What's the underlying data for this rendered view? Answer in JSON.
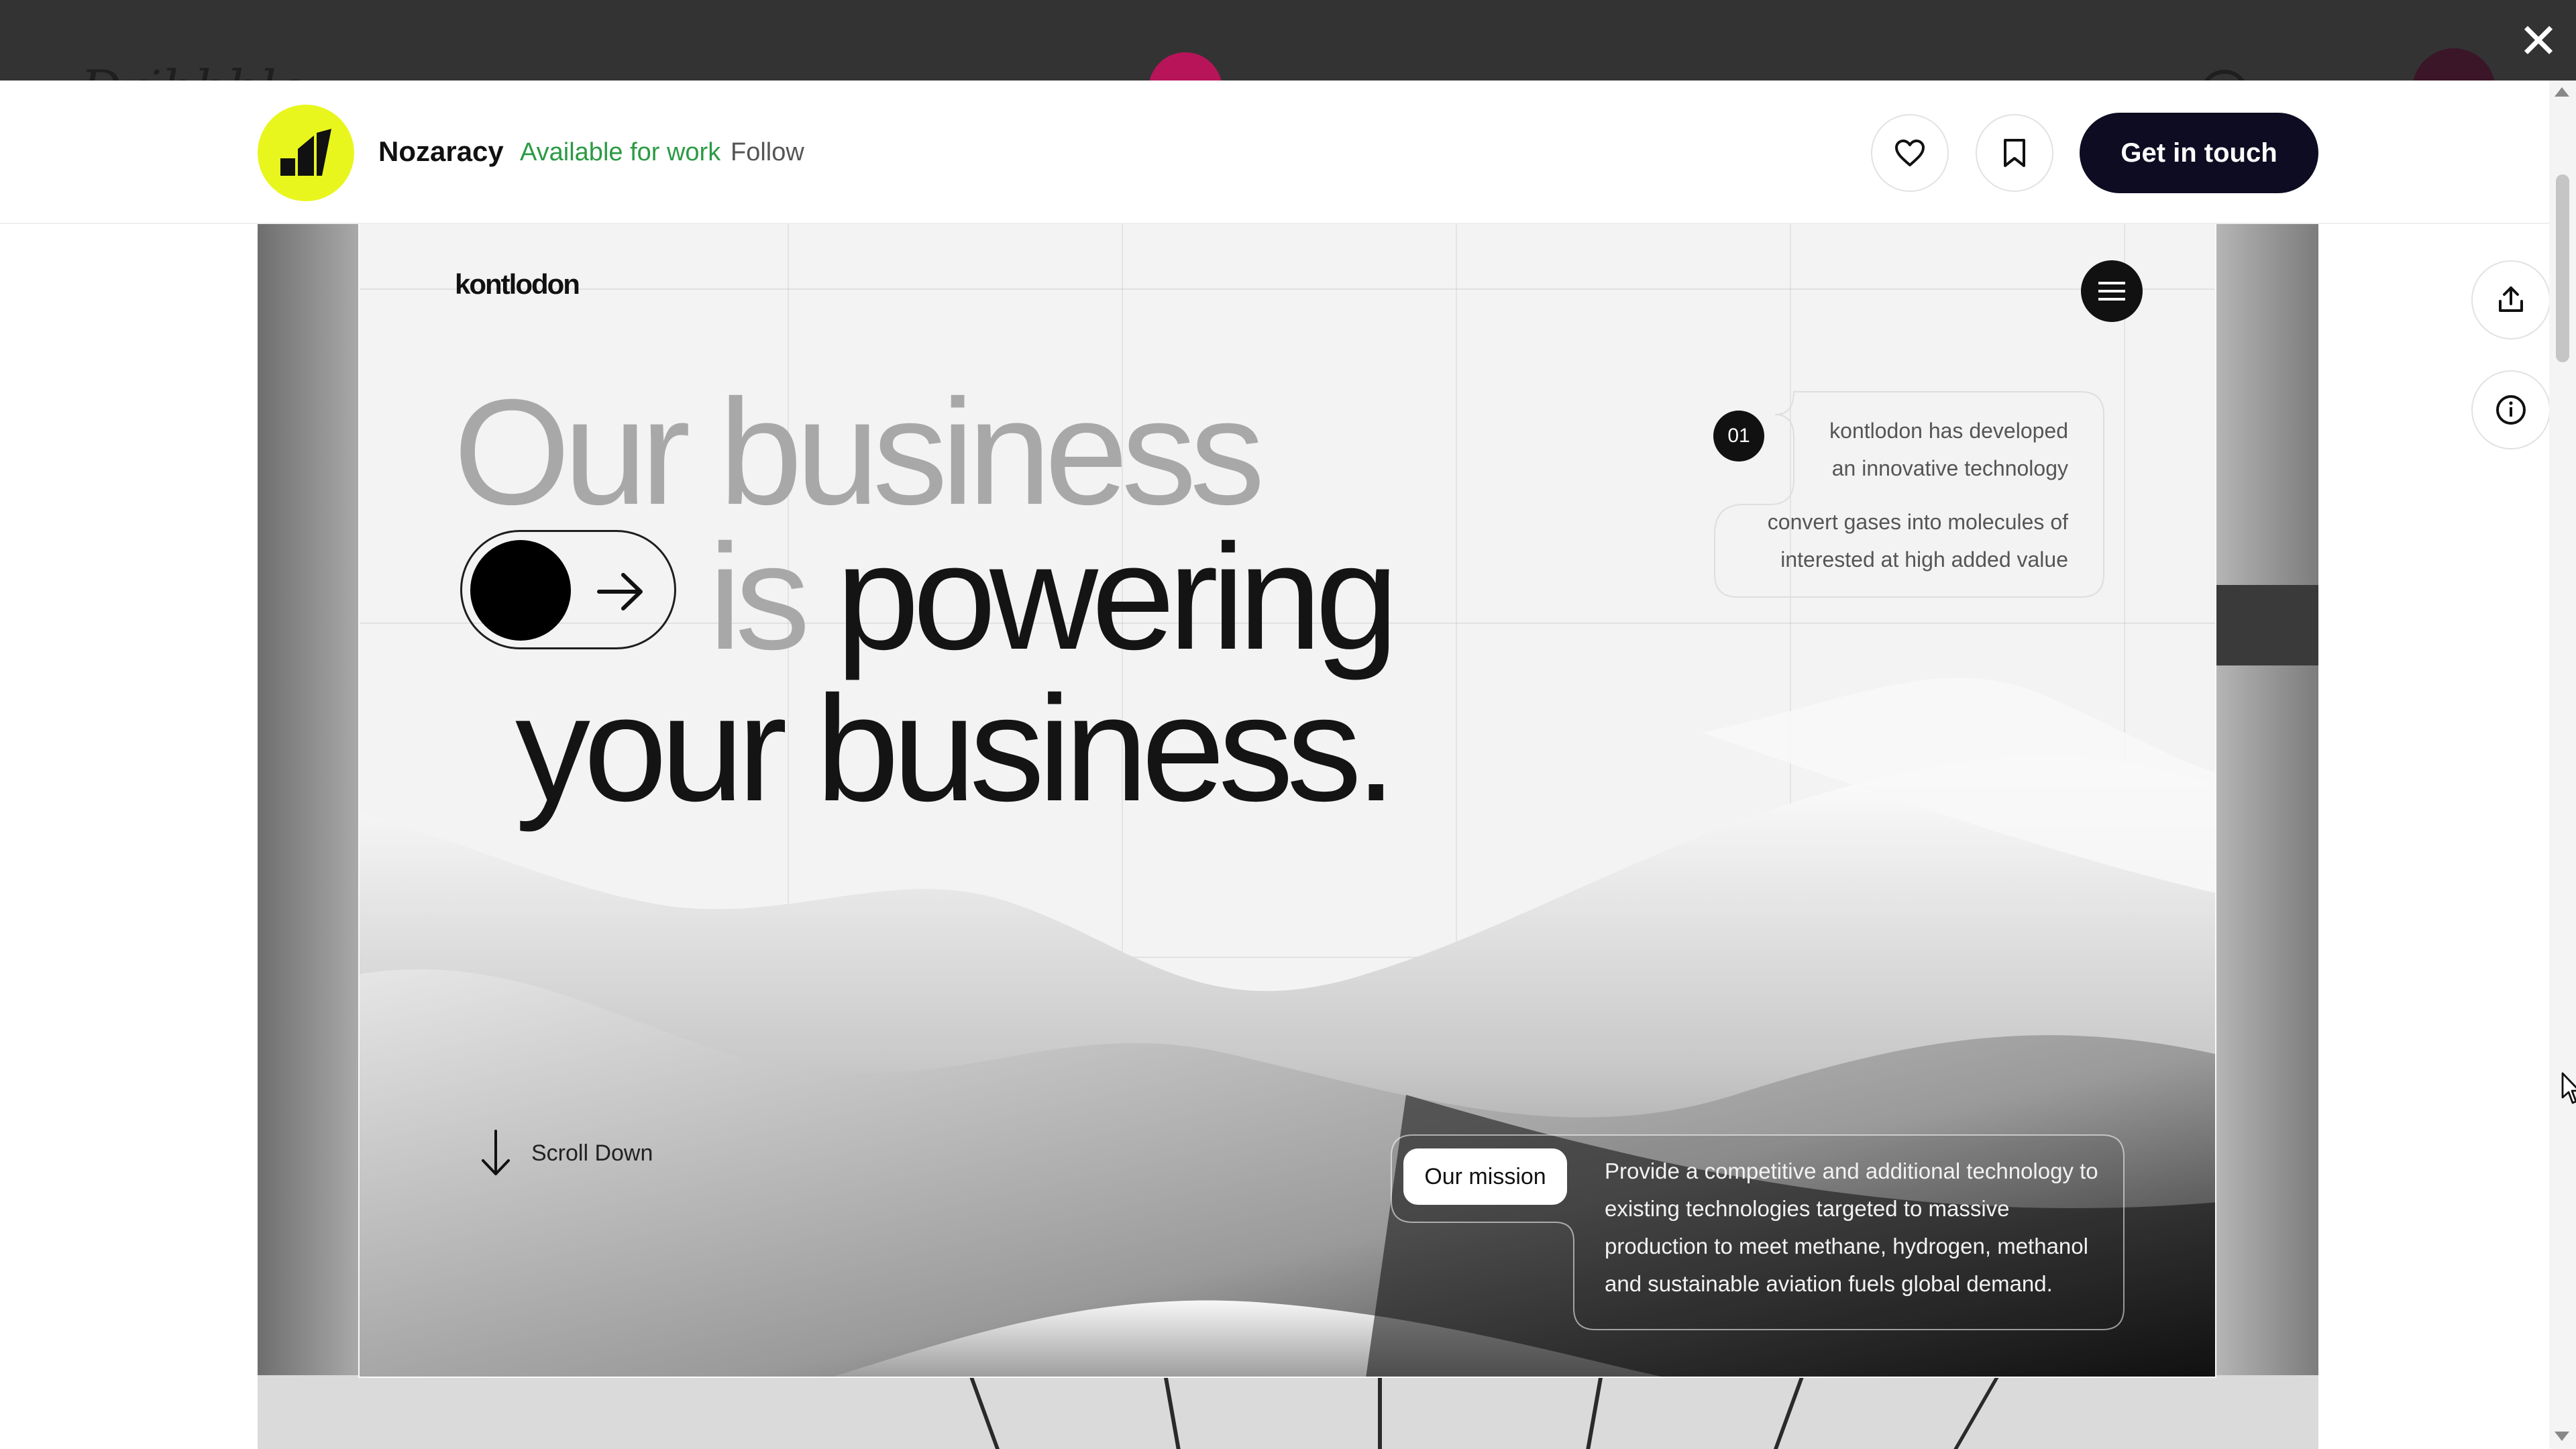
{
  "backdrop": {
    "close_label": "✕"
  },
  "profile": {
    "name": "Nozaracy",
    "status": "Available for work",
    "follow_label": "Follow",
    "cta_label": "Get in touch",
    "avatar_color": "#e8f61e"
  },
  "actions": {
    "like_icon": "heart-icon",
    "save_icon": "bookmark-icon",
    "share_icon": "share-icon",
    "info_icon": "info-icon"
  },
  "shot": {
    "brand": "kontlodon",
    "headline": {
      "line1": "Our business",
      "line2_grey": "is",
      "line2_dark": "powering",
      "line3": "your business."
    },
    "info": {
      "number": "01",
      "line1": "kontlodon has developed",
      "line2": "an innovative technology",
      "line3": "convert  gases into molecules of",
      "line4": "interested at high added value"
    },
    "scroll_label": "Scroll Down",
    "mission": {
      "label": "Our mission",
      "text": "Provide a competitive and additional technology to existing technologies targeted to massive production to meet methane, hydrogen, methanol and sustainable aviation fuels global demand."
    }
  },
  "colors": {
    "cta": "#0d0c22",
    "available": "#2b9a44",
    "headline_grey": "#a8a8a8",
    "headline_dark": "#141414"
  }
}
